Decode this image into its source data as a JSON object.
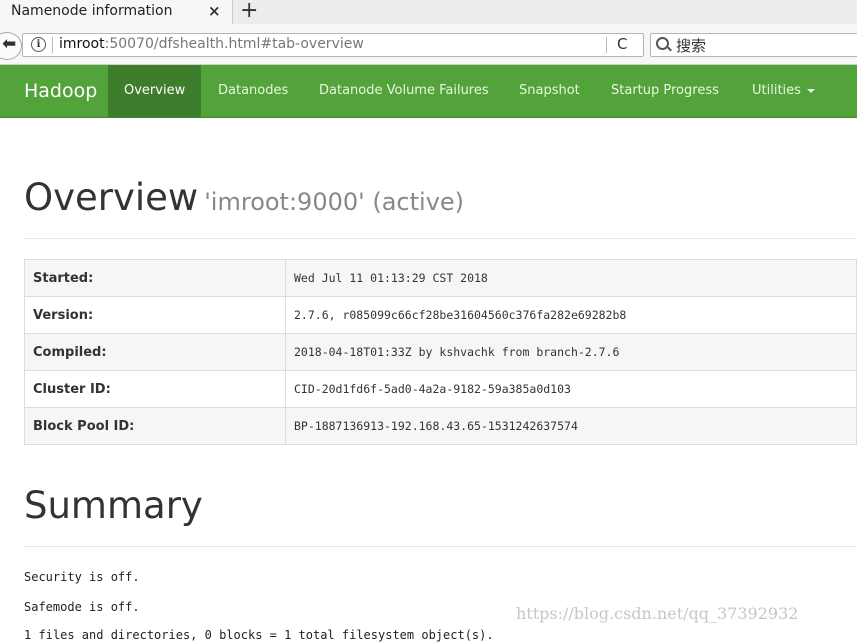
{
  "browser": {
    "tab_title": "Namenode information",
    "tab_close": "×",
    "new_tab": "+",
    "url_host": "imroot",
    "url_rest": ":50070/dfshealth.html#tab-overview",
    "reload": "C",
    "search_placeholder": "搜索"
  },
  "navbar": {
    "brand": "Hadoop",
    "items": [
      {
        "label": "Overview",
        "active": true
      },
      {
        "label": "Datanodes"
      },
      {
        "label": "Datanode Volume Failures"
      },
      {
        "label": "Snapshot"
      },
      {
        "label": "Startup Progress"
      },
      {
        "label": "Utilities"
      }
    ],
    "accent_color": "#53a33b"
  },
  "overview": {
    "title": "Overview",
    "subtitle": "'imroot:9000' (active)",
    "rows": [
      {
        "key": "Started:",
        "value": "Wed Jul 11 01:13:29 CST 2018"
      },
      {
        "key": "Version:",
        "value": "2.7.6, r085099c66cf28be31604560c376fa282e69282b8"
      },
      {
        "key": "Compiled:",
        "value": "2018-04-18T01:33Z by kshvachk from branch-2.7.6"
      },
      {
        "key": "Cluster ID:",
        "value": "CID-20d1fd6f-5ad0-4a2a-9182-59a385a0d103"
      },
      {
        "key": "Block Pool ID:",
        "value": "BP-1887136913-192.168.43.65-1531242637574"
      }
    ]
  },
  "summary": {
    "title": "Summary",
    "lines": [
      "Security is off.",
      "Safemode is off.",
      "1 files and directories, 0 blocks = 1 total filesystem object(s)."
    ]
  },
  "watermark": "https://blog.csdn.net/qq_37392932"
}
